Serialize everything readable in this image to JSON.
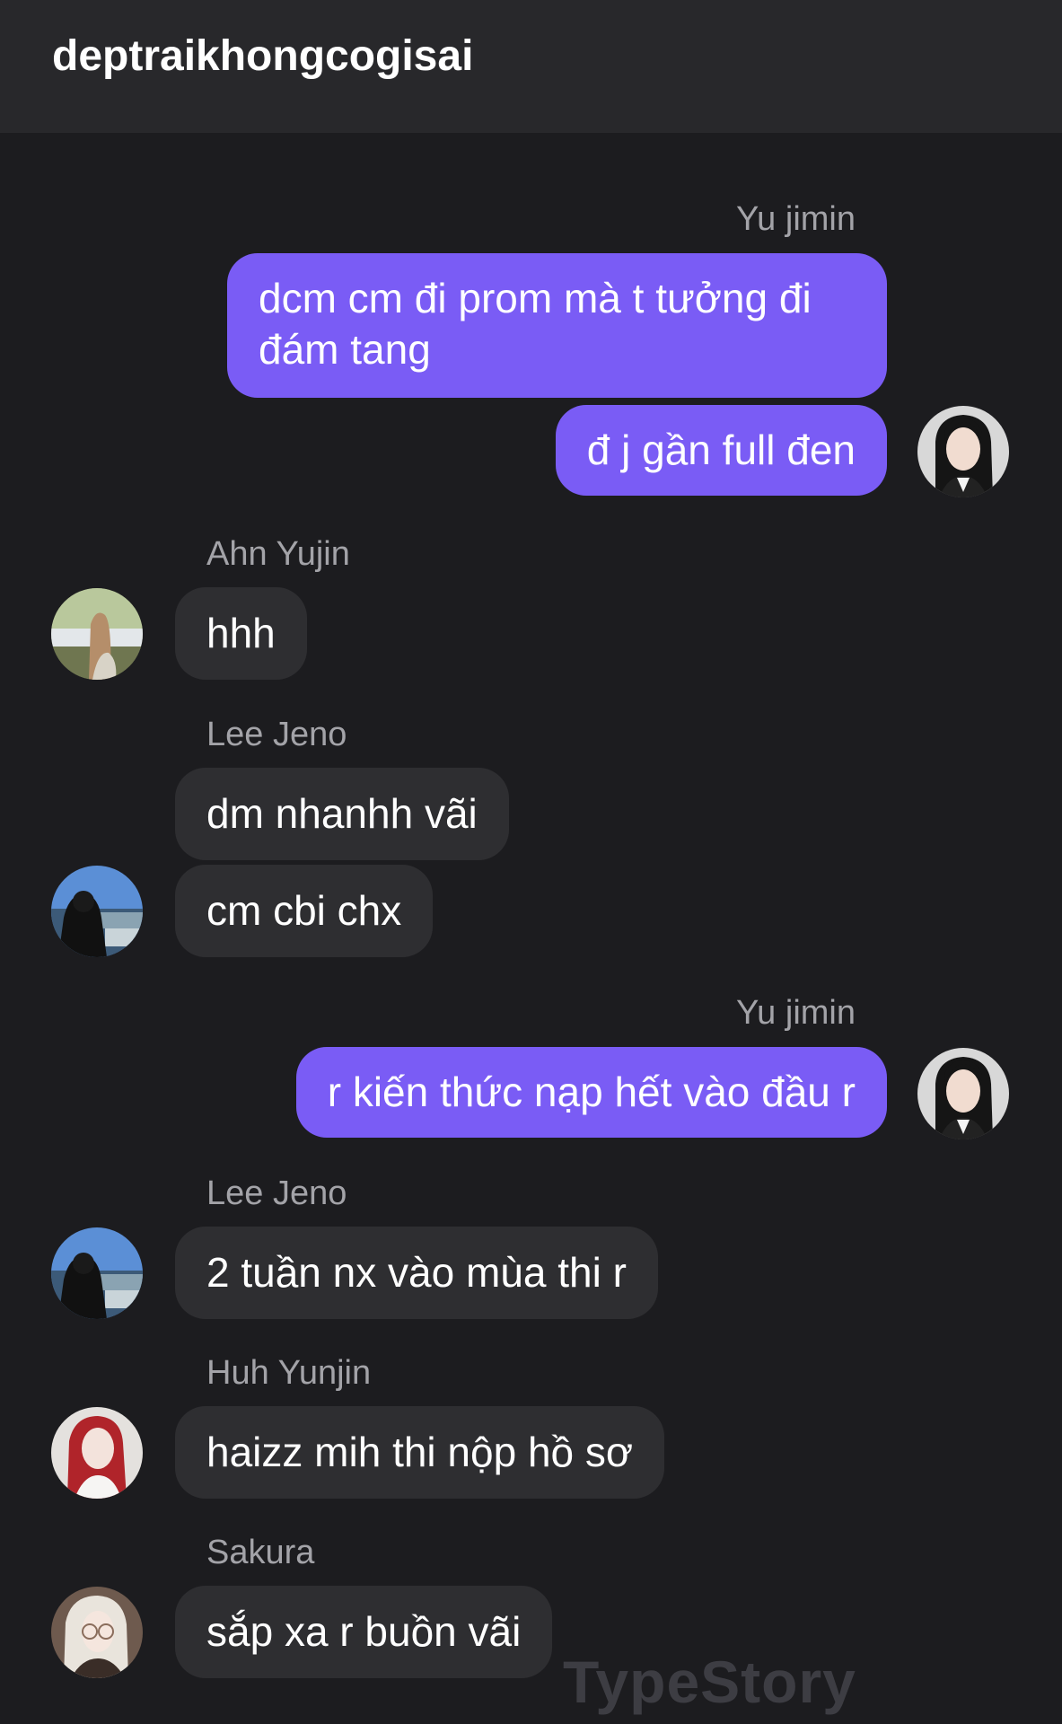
{
  "chat": {
    "title": "deptraikhongcogisai"
  },
  "messages": [
    {
      "sender": "Yu jimin",
      "texts": [
        "dcm cm đi prom mà t tưởng đi đám tang",
        "đ j gần full đen"
      ],
      "outgoing": true
    },
    {
      "sender": "Ahn Yujin",
      "texts": [
        "hhh"
      ],
      "outgoing": false
    },
    {
      "sender": "Lee Jeno",
      "texts": [
        "dm nhanhh vãi",
        "cm cbi chx"
      ],
      "outgoing": false
    },
    {
      "sender": "Yu jimin",
      "texts": [
        "r kiến thức nạp hết vào đầu r"
      ],
      "outgoing": true
    },
    {
      "sender": "Lee Jeno",
      "texts": [
        "2 tuần nx vào mùa thi r"
      ],
      "outgoing": false
    },
    {
      "sender": "Huh Yunjin",
      "texts": [
        "haizz mih thi nộp hồ sơ"
      ],
      "outgoing": false
    },
    {
      "sender": "Sakura",
      "texts": [
        "sắp xa r buồn vãi"
      ],
      "outgoing": false
    }
  ],
  "watermark": "TypeStory",
  "colors": {
    "background": "#1c1c1f",
    "header": "#28282b",
    "outgoing_bubble": "#7a5cf5",
    "incoming_bubble": "#2e2e31",
    "sender_name": "#a3a3a8"
  }
}
